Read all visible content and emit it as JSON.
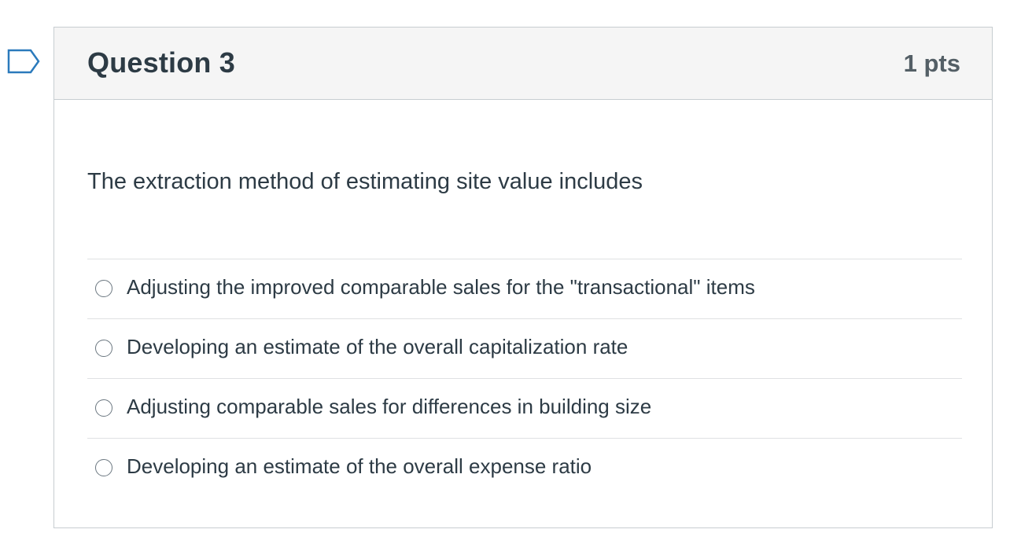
{
  "question": {
    "title": "Question 3",
    "points": "1 pts",
    "text": "The extraction method of estimating site value includes",
    "flag_icon": "bookmark-flag-icon"
  },
  "answers": [
    {
      "label": "Adjusting the improved comparable sales for the \"transactional\" items",
      "selected": false
    },
    {
      "label": "Developing an estimate of the overall capitalization rate",
      "selected": false
    },
    {
      "label": "Adjusting comparable sales for differences in building size",
      "selected": false
    },
    {
      "label": "Developing an estimate of the overall expense ratio",
      "selected": false
    }
  ],
  "colors": {
    "border": "#c7cdd1",
    "header_bg": "#f5f5f5",
    "text": "#2d3b45",
    "flag": "#2b7abc"
  }
}
